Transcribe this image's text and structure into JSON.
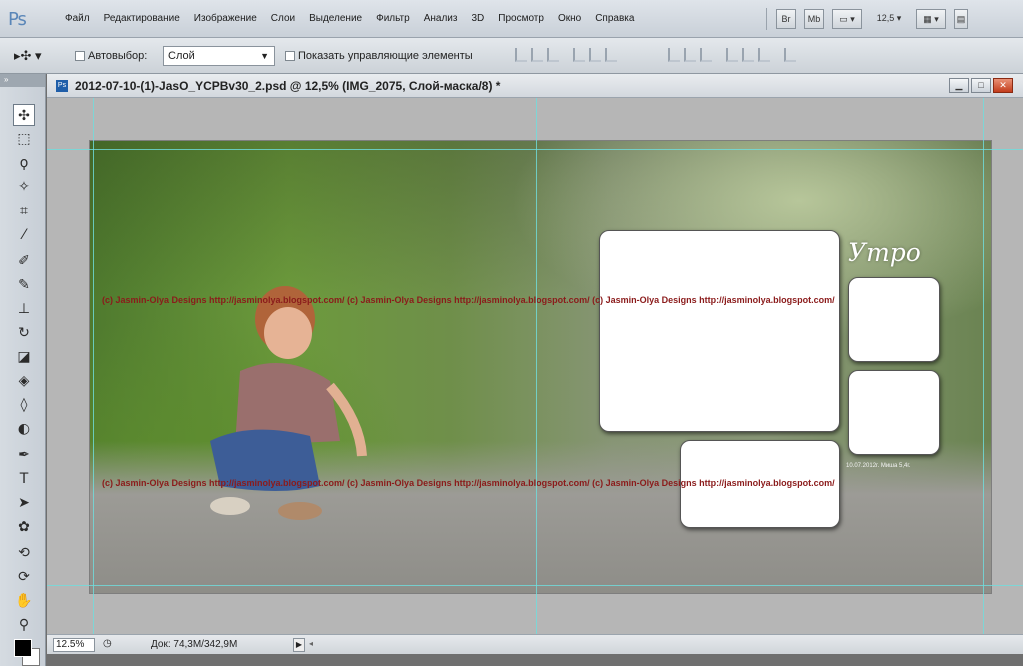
{
  "app": {
    "logo": "Ps"
  },
  "menu": {
    "items": [
      "Файл",
      "Редактирование",
      "Изображение",
      "Слои",
      "Выделение",
      "Фильтр",
      "Анализ",
      "3D",
      "Просмотр",
      "Окно",
      "Справка"
    ],
    "right": {
      "br_label": "Br",
      "mb_label": "Mb",
      "zoom_value": "12,5"
    }
  },
  "options": {
    "auto_select_label": "Автовыбор:",
    "auto_select_value": "Слой",
    "show_controls_label": "Показать управляющие элементы"
  },
  "document": {
    "icon_label": "Ps",
    "title": "2012-07-10-(1)-JasO_YCPBv30_2.psd @ 12,5% (IMG_2075, Слой-маска/8) *",
    "utro_text": "Утро",
    "watermark_1": "(c) Jasmin-Olya Designs http://jasminolya.blogspot.com/   (c) Jasmin-Olya Designs http://jasminolya.blogspot.com/   (c) Jasmin-Olya Designs http://jasminolya.blogspot.com/",
    "watermark_2": "(c) Jasmin-Olya Designs http://jasminolya.blogspot.com/   (c) Jasmin-Olya Designs http://jasminolya.blogspot.com/   (c) Jasmin-Olya Designs http://jasminolya.blogspot.com/",
    "note_line_1": "10.07.2012г. Миша 5,4г."
  },
  "status": {
    "zoom": "12.5%",
    "doc_size": "Док: 74,3M/342,9M"
  },
  "colors": {
    "guide": "#6fdede",
    "watermark": "#8b1b1b",
    "foreground": "#000000",
    "background": "#ffffff"
  }
}
